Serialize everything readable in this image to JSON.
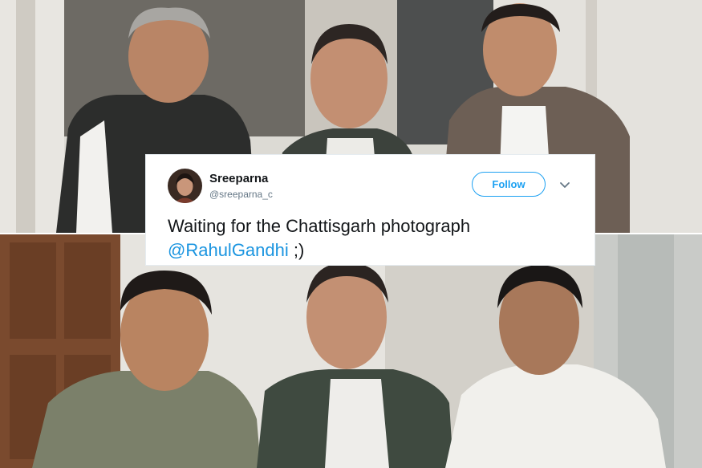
{
  "tweet": {
    "author_name": "Sreeparna",
    "author_handle": "@sreeparna_c",
    "follow_label": "Follow",
    "text": "Waiting for the Chattisgarh photograph",
    "mention": "@RahulGandhi",
    "suffix": " ;)"
  },
  "colors": {
    "accent": "#1da1f2",
    "mention": "#1b95e0",
    "text": "#14171a",
    "muted": "#657786"
  },
  "icons": [
    "chevron-down-icon",
    "avatar"
  ]
}
